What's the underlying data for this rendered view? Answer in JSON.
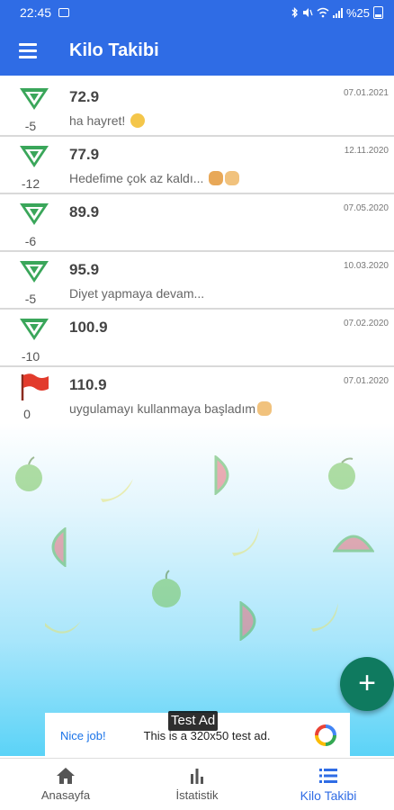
{
  "status_bar": {
    "time": "22:45",
    "battery": "%25",
    "icons": [
      "gallery-icon",
      "bluetooth-icon",
      "mute-icon",
      "wifi-icon",
      "signal-icon",
      "battery-icon"
    ]
  },
  "app_bar": {
    "title": "Kilo Takibi",
    "menu_icon": "menu-icon",
    "color": "#2f6ce5"
  },
  "entries": [
    {
      "weight": "72.9",
      "diff": "-5",
      "note": "ha hayret! ",
      "emoji": "smile",
      "date": "07.01.2021",
      "icon": "down-triangle-icon"
    },
    {
      "weight": "77.9",
      "diff": "-12",
      "note": "Hedefime çok az kaldı... ",
      "emoji": "hands",
      "date": "12.11.2020",
      "icon": "down-triangle-icon"
    },
    {
      "weight": "89.9",
      "diff": "-6",
      "note": "",
      "emoji": "",
      "date": "07.05.2020",
      "icon": "down-triangle-icon"
    },
    {
      "weight": "95.9",
      "diff": "-5",
      "note": "Diyet yapmaya devam...",
      "emoji": "",
      "date": "10.03.2020",
      "icon": "down-triangle-icon"
    },
    {
      "weight": "100.9",
      "diff": "-10",
      "note": "",
      "emoji": "",
      "date": "07.02.2020",
      "icon": "down-triangle-icon"
    },
    {
      "weight": "110.9",
      "diff": "0",
      "note": "uygulamayı kullanmaya başladım",
      "emoji": "ok",
      "date": "07.01.2020",
      "icon": "red-flag-icon"
    }
  ],
  "fab": {
    "label": "+",
    "icon": "plus-icon",
    "color": "#0f7a5f"
  },
  "ad": {
    "label": "Test Ad",
    "nice": "Nice job!",
    "text": "This is a 320x50 test ad.",
    "logo": "ad-logo-icon"
  },
  "bottom_nav": [
    {
      "label": "Anasayfa",
      "icon": "home-icon",
      "active": false
    },
    {
      "label": "İstatistik",
      "icon": "bar-chart-icon",
      "active": false
    },
    {
      "label": "Kilo Takibi",
      "icon": "list-icon",
      "active": true
    }
  ]
}
